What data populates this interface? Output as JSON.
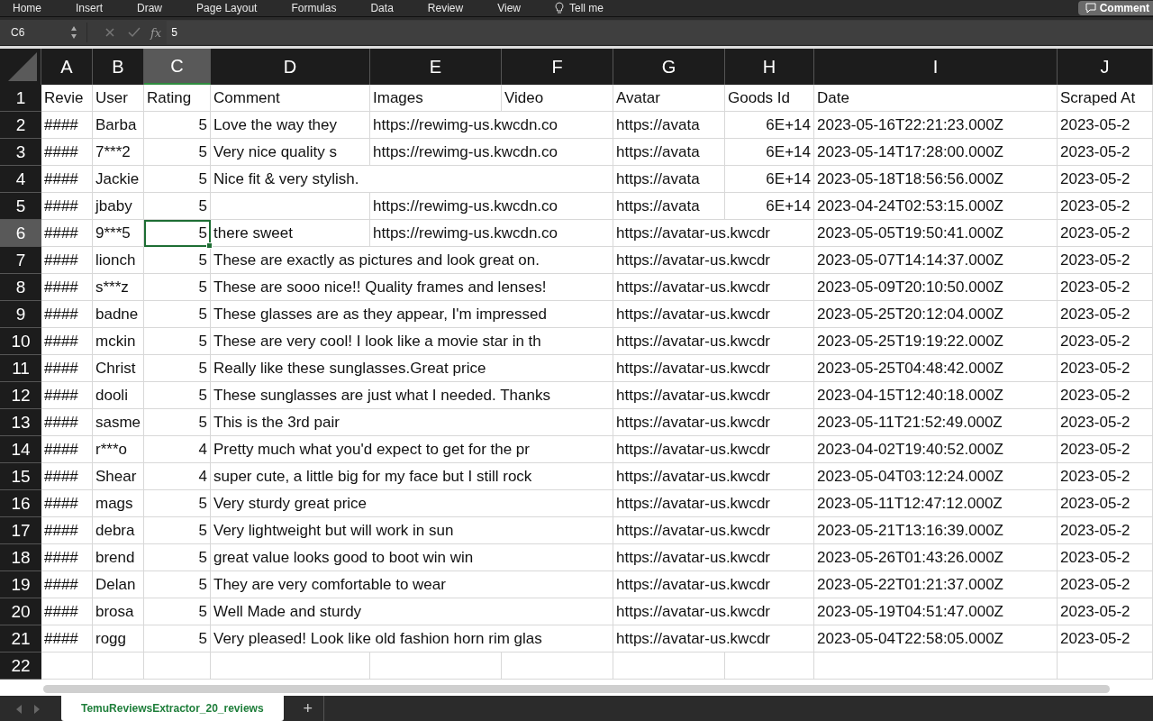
{
  "ribbon": {
    "tabs": [
      "Home",
      "Insert",
      "Draw",
      "Page Layout",
      "Formulas",
      "Data",
      "Review",
      "View"
    ],
    "tell_me": "Tell me",
    "comments_button": "Comment"
  },
  "formula_bar": {
    "name_box": "C6",
    "fx_label": "fx",
    "formula": "5"
  },
  "columns": [
    {
      "letter": "A",
      "kind": "text",
      "selected": false
    },
    {
      "letter": "B",
      "kind": "text",
      "selected": false
    },
    {
      "letter": "C",
      "kind": "number",
      "selected": true
    },
    {
      "letter": "D",
      "kind": "text",
      "selected": false
    },
    {
      "letter": "E",
      "kind": "text",
      "selected": false
    },
    {
      "letter": "F",
      "kind": "text",
      "selected": false
    },
    {
      "letter": "G",
      "kind": "text",
      "selected": false
    },
    {
      "letter": "H",
      "kind": "number",
      "selected": false
    },
    {
      "letter": "I",
      "kind": "text",
      "selected": false
    },
    {
      "letter": "J",
      "kind": "text",
      "selected": false
    }
  ],
  "rows": [
    {
      "number": "1",
      "kind": "header",
      "selected": false,
      "cells": [
        "Revie",
        "User",
        "Rating",
        "Comment",
        "Images",
        "Video",
        "Avatar",
        "Goods Id",
        "Date",
        "Scraped At"
      ]
    },
    {
      "number": "2",
      "kind": "data",
      "selected": false,
      "cells": [
        "####",
        "Barba",
        "5",
        "Love the way they",
        "https://rewimg-us.kwcdn.co",
        "",
        "https://avata",
        "6E+14",
        "2023-05-16T22:21:23.000Z",
        "2023-05-2"
      ]
    },
    {
      "number": "3",
      "kind": "data",
      "selected": false,
      "cells": [
        "####",
        "7***2",
        "5",
        "Very nice quality s",
        "https://rewimg-us.kwcdn.co",
        "",
        "https://avata",
        "6E+14",
        "2023-05-14T17:28:00.000Z",
        "2023-05-2"
      ]
    },
    {
      "number": "4",
      "kind": "data",
      "selected": false,
      "cells": [
        "####",
        "Jackie",
        "5",
        "Nice fit & very stylish.",
        "",
        "",
        "https://avata",
        "6E+14",
        "2023-05-18T18:56:56.000Z",
        "2023-05-2"
      ]
    },
    {
      "number": "5",
      "kind": "data",
      "selected": false,
      "cells": [
        "####",
        "jbaby",
        "5",
        "",
        "https://rewimg-us.kwcdn.co",
        "",
        "https://avata",
        "6E+14",
        "2023-04-24T02:53:15.000Z",
        "2023-05-2"
      ]
    },
    {
      "number": "6",
      "kind": "data",
      "selected": true,
      "cells": [
        "####",
        "9***5",
        "5",
        "there sweet",
        "https://rewimg-us.kwcdn.co",
        "",
        "https://avatar-us.kwcdr",
        "",
        "2023-05-05T19:50:41.000Z",
        "2023-05-2"
      ]
    },
    {
      "number": "7",
      "kind": "data",
      "selected": false,
      "cells": [
        "####",
        "lionch",
        "5",
        "These are exactly as pictures and look great on.",
        "",
        "",
        "https://avatar-us.kwcdr",
        "",
        "2023-05-07T14:14:37.000Z",
        "2023-05-2"
      ]
    },
    {
      "number": "8",
      "kind": "data",
      "selected": false,
      "cells": [
        "####",
        "s***z",
        "5",
        "These are sooo nice!! Quality frames and lenses!",
        "",
        "",
        "https://avatar-us.kwcdr",
        "",
        "2023-05-09T20:10:50.000Z",
        "2023-05-2"
      ]
    },
    {
      "number": "9",
      "kind": "data",
      "selected": false,
      "cells": [
        "####",
        "badne",
        "5",
        "These glasses are as they appear, I'm impressed",
        "",
        "",
        "https://avatar-us.kwcdr",
        "",
        "2023-05-25T20:12:04.000Z",
        "2023-05-2"
      ]
    },
    {
      "number": "10",
      "kind": "data",
      "selected": false,
      "cells": [
        "####",
        "mckin",
        "5",
        "These are very cool! I look like a movie star in th",
        "",
        "",
        "https://avatar-us.kwcdr",
        "",
        "2023-05-25T19:19:22.000Z",
        "2023-05-2"
      ]
    },
    {
      "number": "11",
      "kind": "data",
      "selected": false,
      "cells": [
        "####",
        "Christ",
        "5",
        "Really like these sunglasses.Great price",
        "",
        "",
        "https://avatar-us.kwcdr",
        "",
        "2023-05-25T04:48:42.000Z",
        "2023-05-2"
      ]
    },
    {
      "number": "12",
      "kind": "data",
      "selected": false,
      "cells": [
        "####",
        "dooli",
        "5",
        "These sunglasses are just what I needed. Thanks",
        "",
        "",
        "https://avatar-us.kwcdr",
        "",
        "2023-04-15T12:40:18.000Z",
        "2023-05-2"
      ]
    },
    {
      "number": "13",
      "kind": "data",
      "selected": false,
      "cells": [
        "####",
        "sasme",
        "5",
        "This is the 3rd pair",
        "",
        "",
        "https://avatar-us.kwcdr",
        "",
        "2023-05-11T21:52:49.000Z",
        "2023-05-2"
      ]
    },
    {
      "number": "14",
      "kind": "data",
      "selected": false,
      "cells": [
        "####",
        "r***o",
        "4",
        "Pretty much what you'd expect to get for the pr",
        "",
        "",
        "https://avatar-us.kwcdr",
        "",
        "2023-04-02T19:40:52.000Z",
        "2023-05-2"
      ]
    },
    {
      "number": "15",
      "kind": "data",
      "selected": false,
      "cells": [
        "####",
        "Shear",
        "4",
        "super cute, a little big for my face but I still rock",
        "",
        "",
        "https://avatar-us.kwcdr",
        "",
        "2023-05-04T03:12:24.000Z",
        "2023-05-2"
      ]
    },
    {
      "number": "16",
      "kind": "data",
      "selected": false,
      "cells": [
        "####",
        "mags",
        "5",
        "Very sturdy great price",
        "",
        "",
        "https://avatar-us.kwcdr",
        "",
        "2023-05-11T12:47:12.000Z",
        "2023-05-2"
      ]
    },
    {
      "number": "17",
      "kind": "data",
      "selected": false,
      "cells": [
        "####",
        "debra",
        "5",
        "Very lightweight but will work in sun",
        "",
        "",
        "https://avatar-us.kwcdr",
        "",
        "2023-05-21T13:16:39.000Z",
        "2023-05-2"
      ]
    },
    {
      "number": "18",
      "kind": "data",
      "selected": false,
      "cells": [
        "####",
        "brend",
        "5",
        "great value looks good to boot win win",
        "",
        "",
        "https://avatar-us.kwcdr",
        "",
        "2023-05-26T01:43:26.000Z",
        "2023-05-2"
      ]
    },
    {
      "number": "19",
      "kind": "data",
      "selected": false,
      "cells": [
        "####",
        "Delan",
        "5",
        "They are very comfortable to wear",
        "",
        "",
        "https://avatar-us.kwcdr",
        "",
        "2023-05-22T01:21:37.000Z",
        "2023-05-2"
      ]
    },
    {
      "number": "20",
      "kind": "data",
      "selected": false,
      "cells": [
        "####",
        "brosa",
        "5",
        "Well Made and sturdy",
        "",
        "",
        "https://avatar-us.kwcdr",
        "",
        "2023-05-19T04:51:47.000Z",
        "2023-05-2"
      ]
    },
    {
      "number": "21",
      "kind": "data",
      "selected": false,
      "cells": [
        "####",
        "rogg",
        "5",
        "Very pleased! Look like old fashion horn rim glas",
        "",
        "",
        "https://avatar-us.kwcdr",
        "",
        "2023-05-04T22:58:05.000Z",
        "2023-05-2"
      ]
    },
    {
      "number": "22",
      "kind": "data",
      "selected": false
    }
  ],
  "sheet_tabs": [
    {
      "label": "TemuReviewsExtractor_20_reviews",
      "selected": true
    }
  ],
  "add_sheet_label": "+"
}
